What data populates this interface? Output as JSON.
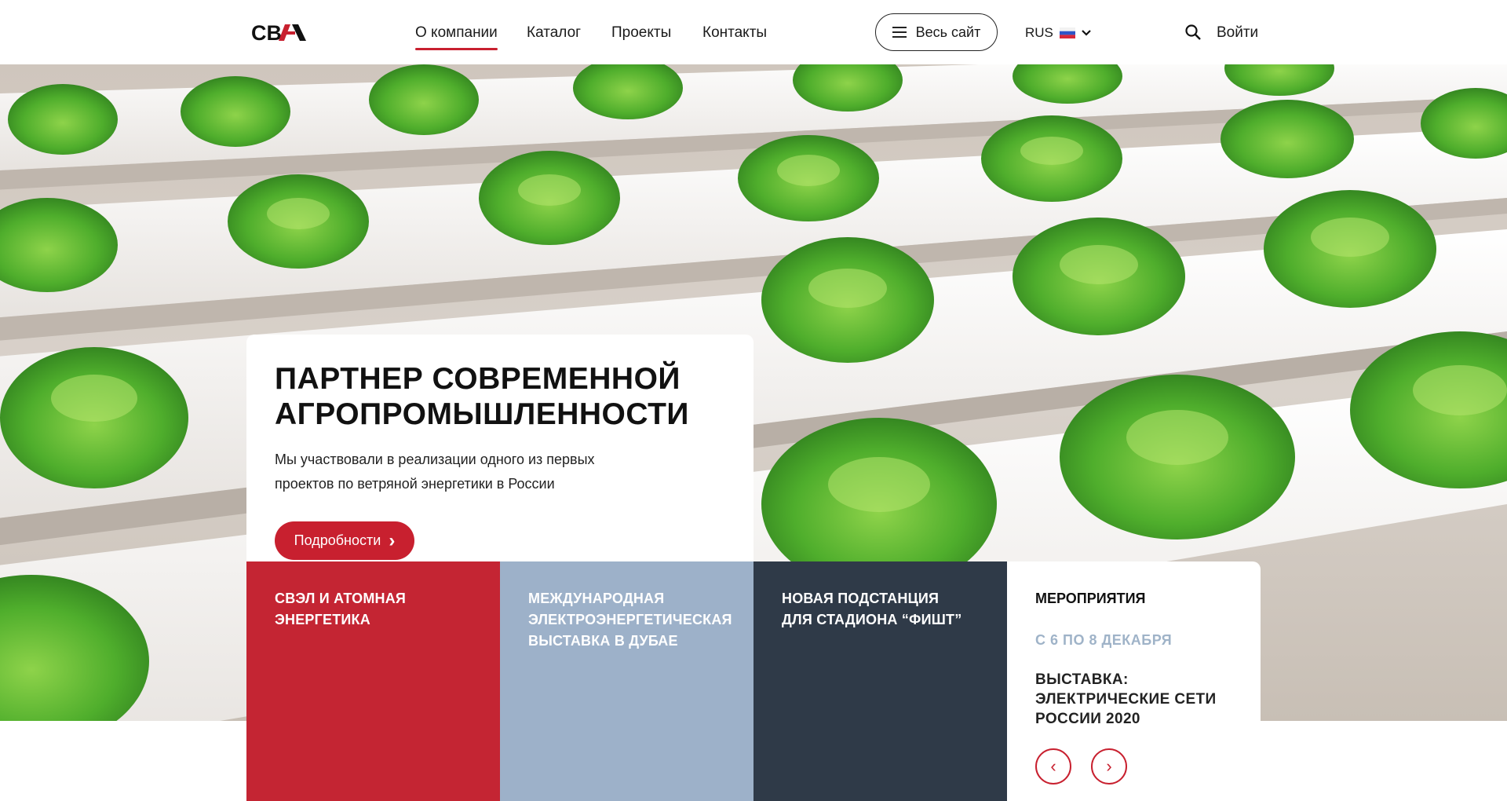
{
  "header": {
    "logo_text": "СВЭЛ",
    "nav": [
      "О компании",
      "Каталог",
      "Проекты",
      "Контакты"
    ],
    "all_site_label": "Весь сайт",
    "lang_label": "RUS",
    "login_label": "Войти",
    "icons": {
      "menu": "menu-icon",
      "flag": "russia-flag-icon",
      "chevron": "chevron-down-icon",
      "search": "search-icon"
    }
  },
  "hero": {
    "title_line1": "ПАРТНЕР СОВРЕМЕННОЙ",
    "title_line2": "АГРОПРОМЫШЛЕННОСТИ",
    "text_line1": "Мы участвовали в реализации одного из первых",
    "text_line2": "проектов по ветряной энергетики в России",
    "button_label": "Подробности",
    "button_arrow": "›"
  },
  "tiles": [
    {
      "line1": "СВЭЛ И АТОМНАЯ",
      "line2": "ЭНЕРГЕТИКА",
      "line3": ""
    },
    {
      "line1": "МЕЖДУНАРОДНАЯ",
      "line2": "ЭЛЕКТРОЭНЕРГЕТИЧЕСКАЯ",
      "line3": "ВЫСТАВКА В ДУБАЕ"
    },
    {
      "line1": "НОВАЯ ПОДСТАНЦИЯ",
      "line2": "ДЛЯ СТАДИОНА “ФИШТ”",
      "line3": ""
    }
  ],
  "events": {
    "heading": "МЕРОПРИЯТИЯ",
    "date": "С 6 ПО 8 ДЕКАБРЯ",
    "title_line1": "ВЫСТАВКА:",
    "title_line2": "ЭЛЕКТРИЧЕСКИЕ СЕТИ",
    "title_line3": "РОССИИ 2020",
    "prev": "‹",
    "next": "›"
  },
  "colors": {
    "accent": "#c8202f",
    "tile_red": "#c42533",
    "tile_blue": "#9db1c9",
    "tile_dark": "#2f3a48",
    "date": "#9fb3c8"
  }
}
